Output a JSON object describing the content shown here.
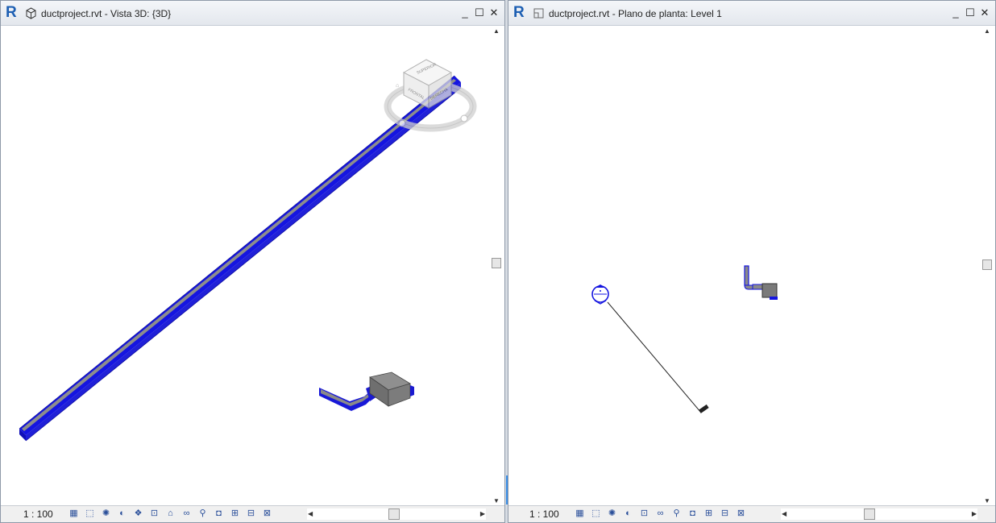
{
  "left_window": {
    "title": "ductproject.rvt - Vista 3D: {3D}",
    "scale": "1 : 100",
    "viewcube_faces": [
      "SUPERIOR",
      "FRONTAL",
      "DERECHA"
    ],
    "view_control_icons": [
      "detail-level-icon",
      "visual-style-icon",
      "sun-path-icon",
      "shadows-icon",
      "rendering-icon",
      "crop-view-icon",
      "show-crop-icon",
      "unlock-3d-icon",
      "temporary-hide-icon",
      "reveal-hidden-icon",
      "worksharing-icon",
      "design-options-icon",
      "highlight-displacement-icon"
    ]
  },
  "right_window": {
    "title": "ductproject.rvt - Plano de planta: Level 1",
    "scale": "1 : 100",
    "view_control_icons": [
      "detail-level-icon",
      "visual-style-icon",
      "sun-path-icon",
      "shadows-icon",
      "crop-view-icon",
      "show-crop-icon",
      "temporary-hide-icon",
      "reveal-hidden-icon",
      "worksharing-icon",
      "design-options-icon",
      "highlight-displacement-icon"
    ]
  },
  "window_controls": {
    "minimize": "_",
    "maximize": "☐",
    "close": "✕"
  },
  "colors": {
    "selection_blue": "#1515e0",
    "duct_gray": "#8c8c8c",
    "accent": "#1d5fb3"
  }
}
